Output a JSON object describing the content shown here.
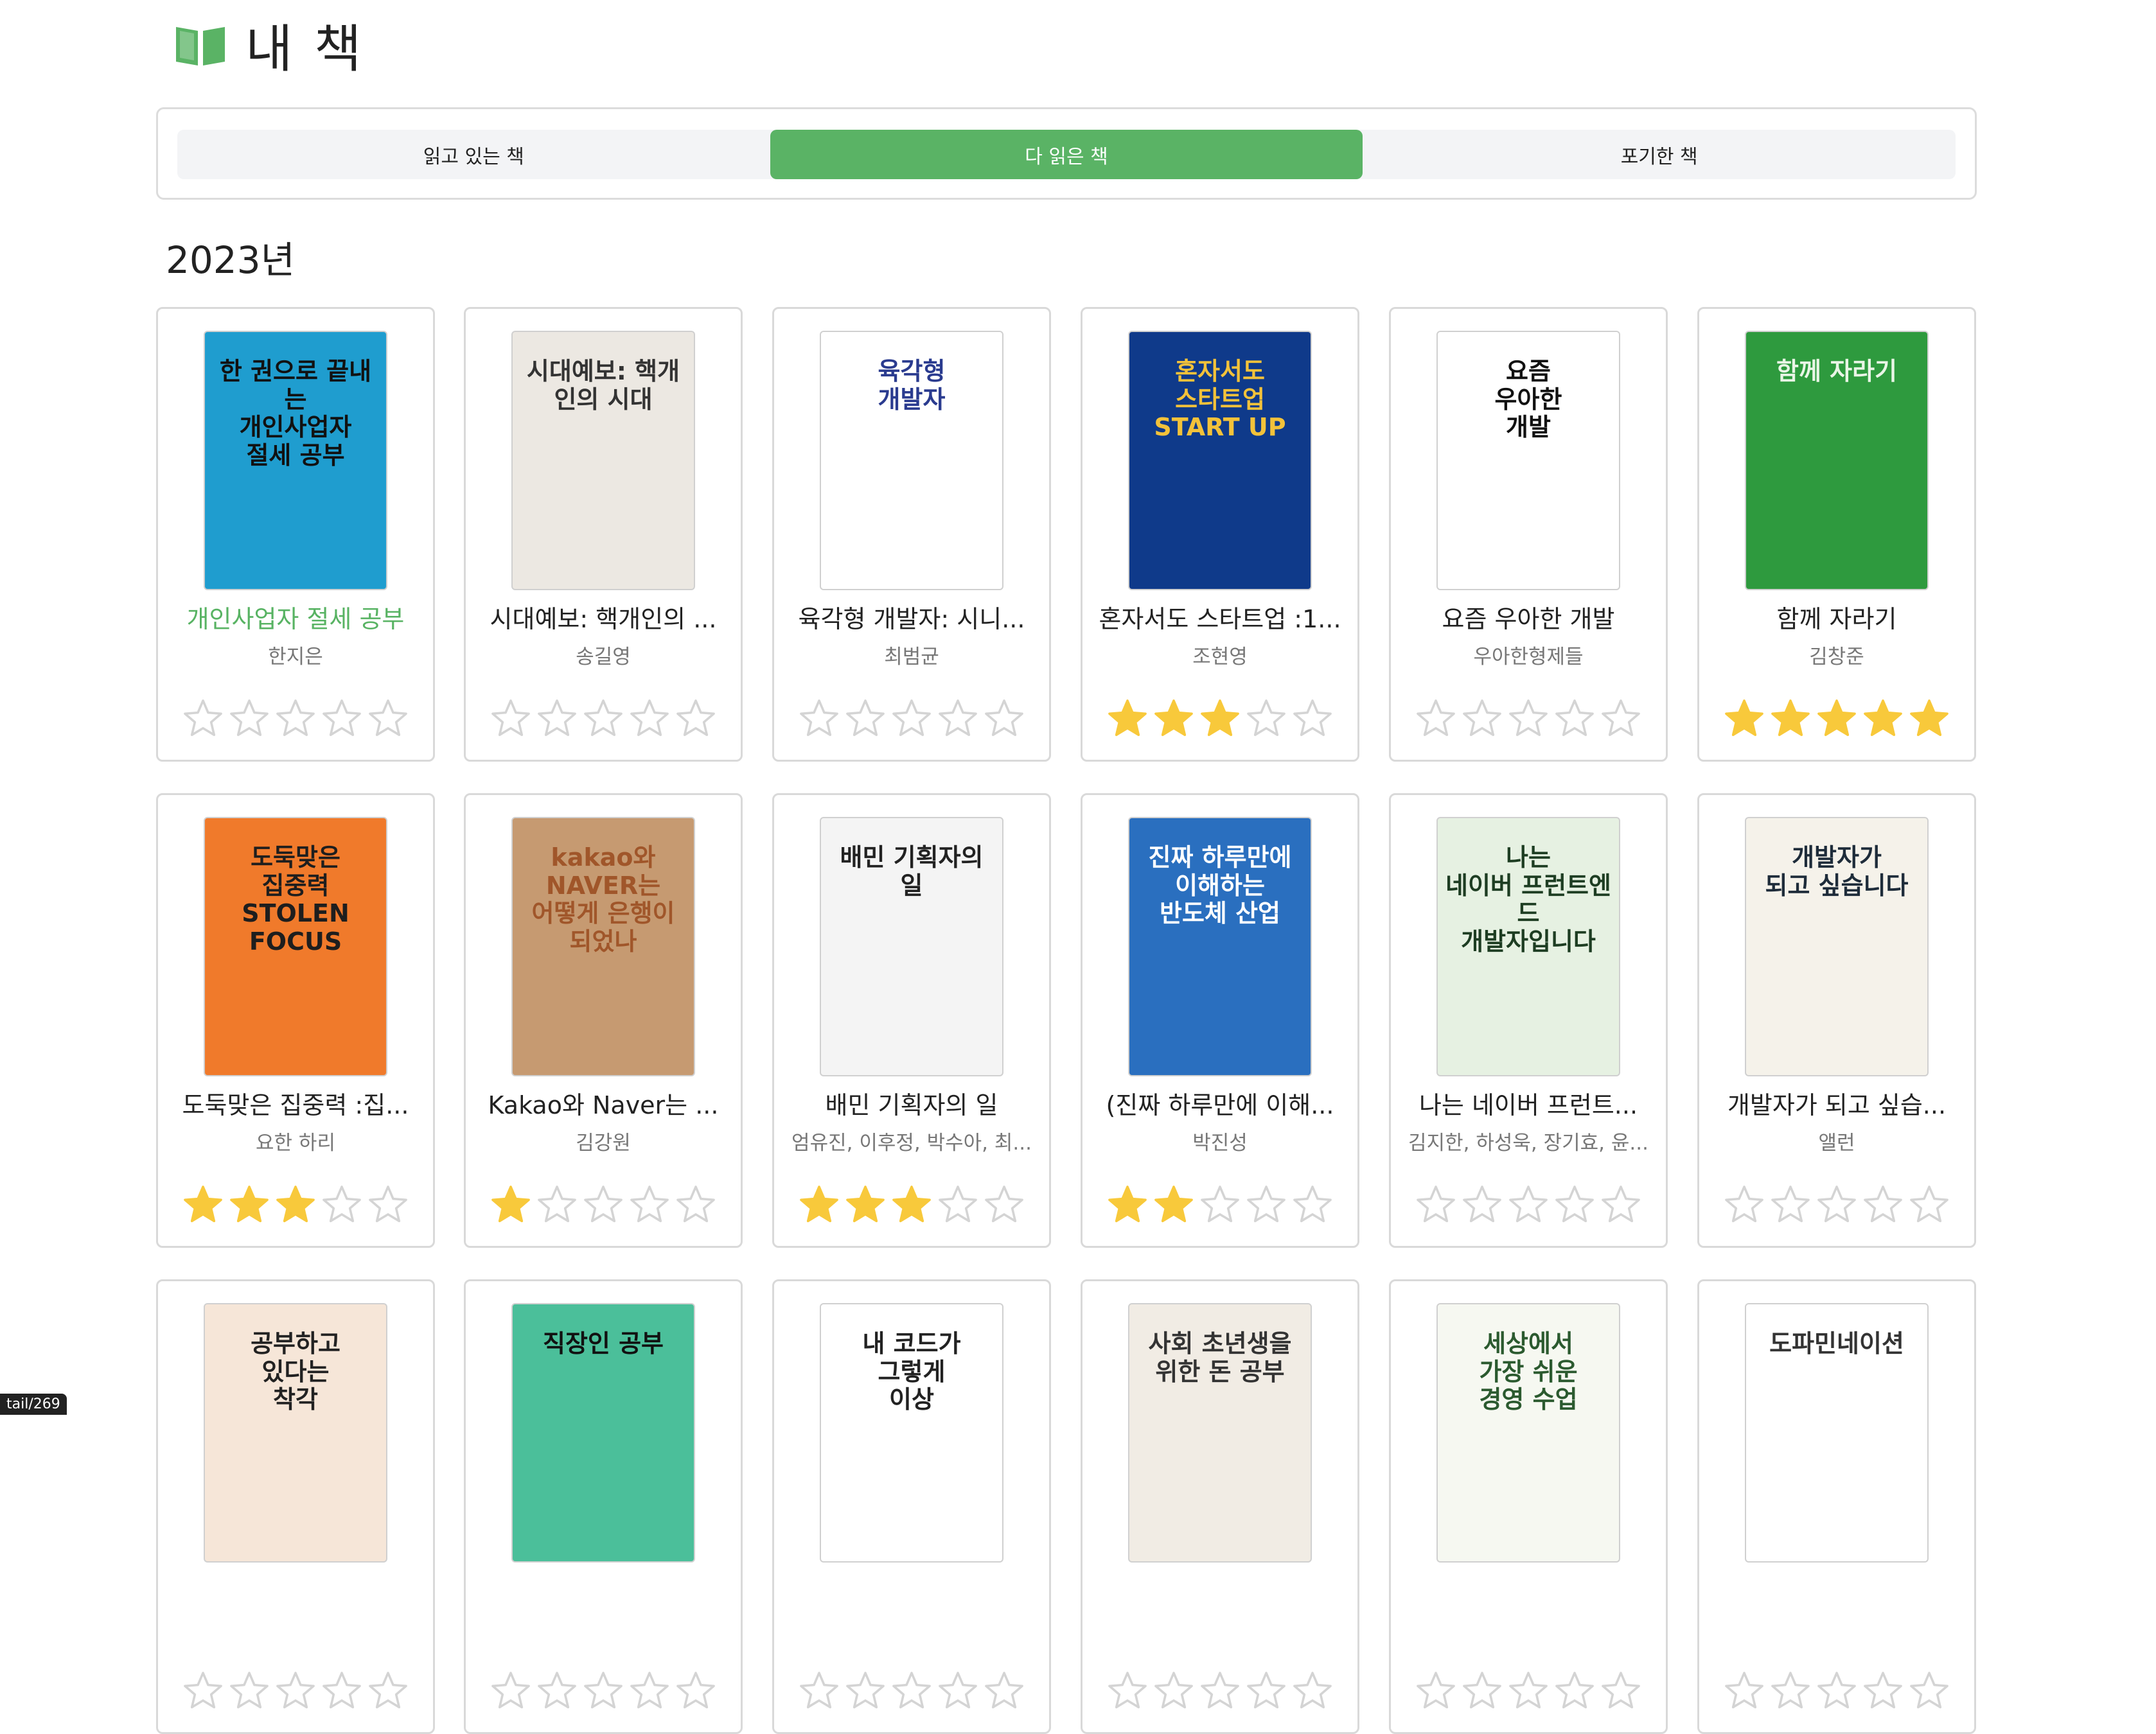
{
  "page": {
    "title": "내 책",
    "year_heading": "2023년",
    "status_hint": "tail/269"
  },
  "tabs": [
    {
      "label": "읽고 있는 책",
      "active": false
    },
    {
      "label": "다 읽은 책",
      "active": true
    },
    {
      "label": "포기한 책",
      "active": false
    }
  ],
  "colors": {
    "accent": "#5ab365",
    "star_fill": "#f8c93b",
    "star_empty": "#d4d4d4"
  },
  "books": [
    {
      "title": "개인사업자 절세 공부",
      "author": "한지은",
      "rating": 0,
      "linked": true,
      "cover": {
        "bg": "#1f9dcf",
        "fg": "#111",
        "text": "한 권으로 끝내는\n개인사업자\n절세 공부"
      }
    },
    {
      "title": "시대예보: 핵개인의 ...",
      "author": "송길영",
      "rating": 0,
      "cover": {
        "bg": "#ece8e2",
        "fg": "#333",
        "text": "시대예보: 핵개인의 시대"
      }
    },
    {
      "title": "육각형 개발자: 시니...",
      "author": "최범균",
      "rating": 0,
      "cover": {
        "bg": "#ffffff",
        "fg": "#2a3b8f",
        "text": "육각형\n개발자"
      }
    },
    {
      "title": "혼자서도 스타트업 :1...",
      "author": "조현영",
      "rating": 3,
      "cover": {
        "bg": "#0f3a8a",
        "fg": "#f3c23a",
        "text": "혼자서도\n스타트업\nSTART UP"
      }
    },
    {
      "title": "요즘 우아한 개발",
      "author": "우아한형제들",
      "rating": 0,
      "cover": {
        "bg": "#ffffff",
        "fg": "#111",
        "text": "요즘\n우아한\n개발"
      }
    },
    {
      "title": "함께 자라기",
      "author": "김창준",
      "rating": 5,
      "cover": {
        "bg": "#2e9a3e",
        "fg": "#e9f5e6",
        "text": "함께 자라기"
      }
    },
    {
      "title": "도둑맞은 집중력 :집...",
      "author": "요한 하리",
      "rating": 3,
      "cover": {
        "bg": "#f07a2b",
        "fg": "#1e1e1e",
        "text": "도둑맞은\n집중력\nSTOLEN\nFOCUS"
      }
    },
    {
      "title": "Kakao와 Naver는 ...",
      "author": "김강원",
      "rating": 1,
      "cover": {
        "bg": "#c69a71",
        "fg": "#a0562a",
        "text": "kakao와 NAVER는\n어떻게 은행이 되었나"
      }
    },
    {
      "title": "배민 기획자의 일",
      "author": "엄유진, 이후정, 박수아, 최...",
      "rating": 3,
      "cover": {
        "bg": "#f4f4f4",
        "fg": "#222",
        "text": "배민 기획자의 일"
      }
    },
    {
      "title": "(진짜 하루만에 이해...",
      "author": "박진성",
      "rating": 2,
      "cover": {
        "bg": "#2a6fbf",
        "fg": "#ffffff",
        "text": "진짜 하루만에 이해하는\n반도체 산업"
      }
    },
    {
      "title": "나는 네이버 프런트...",
      "author": "김지한, 하성욱, 장기효, 윤...",
      "rating": 0,
      "cover": {
        "bg": "#e6f1e2",
        "fg": "#1d3d22",
        "text": "나는\n네이버 프런트엔드\n개발자입니다"
      }
    },
    {
      "title": "개발자가 되고 싶습...",
      "author": "앨런",
      "rating": 0,
      "cover": {
        "bg": "#f5f2ea",
        "fg": "#1e2c3a",
        "text": "개발자가\n되고 싶습니다"
      }
    },
    {
      "title": "",
      "author": "",
      "rating": 0,
      "cover": {
        "bg": "#f6e6d8",
        "fg": "#222",
        "text": "공부하고\n있다는\n착각"
      }
    },
    {
      "title": "",
      "author": "",
      "rating": 0,
      "cover": {
        "bg": "#4bbf9a",
        "fg": "#111",
        "text": "직장인 공부"
      }
    },
    {
      "title": "",
      "author": "",
      "rating": 0,
      "cover": {
        "bg": "#ffffff",
        "fg": "#222",
        "text": "내 코드가\n그렇게\n이상"
      }
    },
    {
      "title": "",
      "author": "",
      "rating": 0,
      "cover": {
        "bg": "#f1ece4",
        "fg": "#333",
        "text": "사회 초년생을 위한 돈 공부"
      }
    },
    {
      "title": "",
      "author": "",
      "rating": 0,
      "cover": {
        "bg": "#f6f8f1",
        "fg": "#2b5a2f",
        "text": "세상에서\n가장 쉬운\n경영 수업"
      }
    },
    {
      "title": "",
      "author": "",
      "rating": 0,
      "cover": {
        "bg": "#ffffff",
        "fg": "#333",
        "text": "도파민네이션"
      }
    }
  ]
}
